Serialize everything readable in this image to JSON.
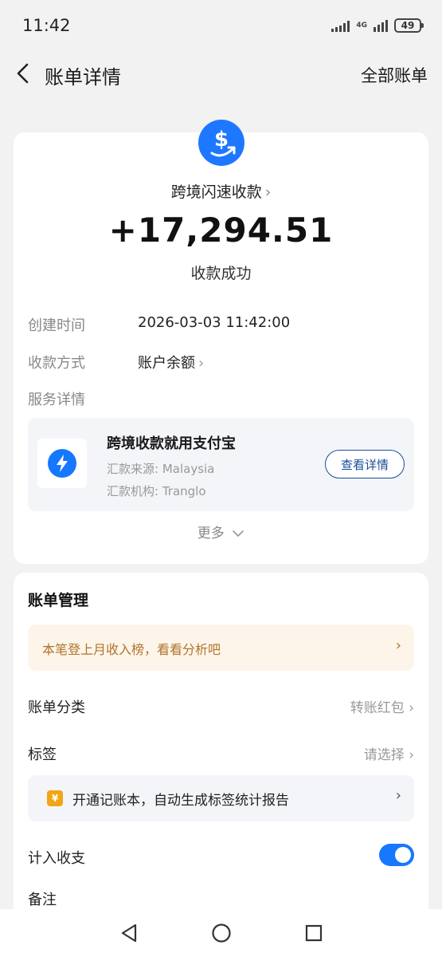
{
  "status_bar": {
    "time": "11:42",
    "network": "4G",
    "battery": "49"
  },
  "nav": {
    "title": "账单详情",
    "right_link": "全部账单"
  },
  "transaction": {
    "name": "跨境闪速收款",
    "amount": "+17,294.51",
    "status": "收款成功",
    "fields": [
      {
        "label": "创建时间",
        "value": "2026-03-03 11:42:00"
      },
      {
        "label": "收款方式",
        "value": "账户余额"
      },
      {
        "label": "服务详情",
        "value": ""
      }
    ],
    "brand_color": "#1e78ff"
  },
  "service": {
    "title": "跨境收款就用支付宝",
    "lines": [
      "汇款来源: Malaysia",
      "汇款机构: Tranglo"
    ],
    "button_label": "查看详情"
  },
  "more_label": "更多",
  "management": {
    "title": "账单管理",
    "promo_text": "本笔登上月收入榜，看看分析吧",
    "rows": [
      {
        "label": "账单分类",
        "value": "转账红包"
      },
      {
        "label": "标签",
        "value": "请选择"
      }
    ],
    "ledger_icon": "¥",
    "ledger_text": "开通记账本，自动生成标签统计报告",
    "toggle_label": "计入收支",
    "toggle_on": true,
    "note_label": "备注"
  }
}
